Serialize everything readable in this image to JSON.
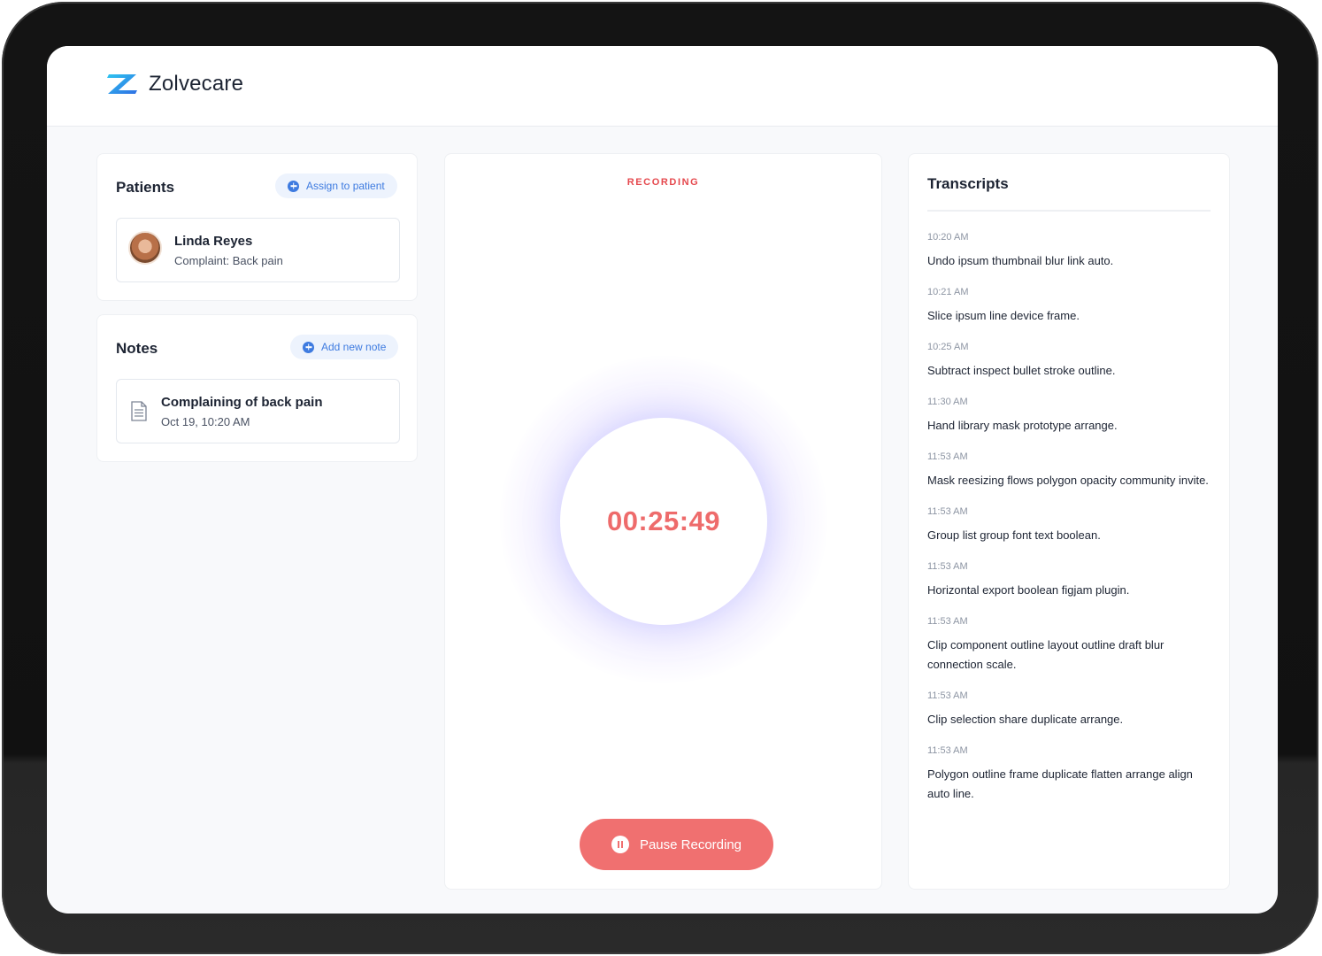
{
  "app": {
    "name": "Zolvecare"
  },
  "patients": {
    "title": "Patients",
    "assign_label": "Assign to patient",
    "patient": {
      "name": "Linda Reyes",
      "complaint": "Complaint: Back pain"
    }
  },
  "notes": {
    "title": "Notes",
    "add_label": "Add new note",
    "note": {
      "title": "Complaining of back pain",
      "date": "Oct 19, 10:20 AM"
    }
  },
  "recording": {
    "status": "RECORDING",
    "timer": "00:25:49",
    "pause_label": "Pause Recording"
  },
  "transcripts": {
    "title": "Transcripts",
    "entries": [
      {
        "time": "10:20 AM",
        "text": "Undo ipsum thumbnail blur link auto."
      },
      {
        "time": "10:21 AM",
        "text": "Slice ipsum line device frame."
      },
      {
        "time": "10:25 AM",
        "text": "Subtract inspect bullet stroke outline."
      },
      {
        "time": "11:30 AM",
        "text": "Hand library mask prototype arrange."
      },
      {
        "time": "11:53 AM",
        "text": "Mask reesizing flows polygon opacity community invite."
      },
      {
        "time": "11:53 AM",
        "text": "Group list group font text boolean."
      },
      {
        "time": "11:53 AM",
        "text": "Horizontal export boolean figjam plugin."
      },
      {
        "time": "11:53 AM",
        "text": "Clip component outline layout outline draft blur connection scale."
      },
      {
        "time": "11:53 AM",
        "text": "Clip selection share duplicate arrange."
      },
      {
        "time": "11:53 AM",
        "text": "Polygon outline frame duplicate flatten arrange align auto line."
      }
    ]
  },
  "colors": {
    "accent_blue": "#3e7be0",
    "record_red": "#f07070",
    "timer_red": "#ee6b6b"
  }
}
